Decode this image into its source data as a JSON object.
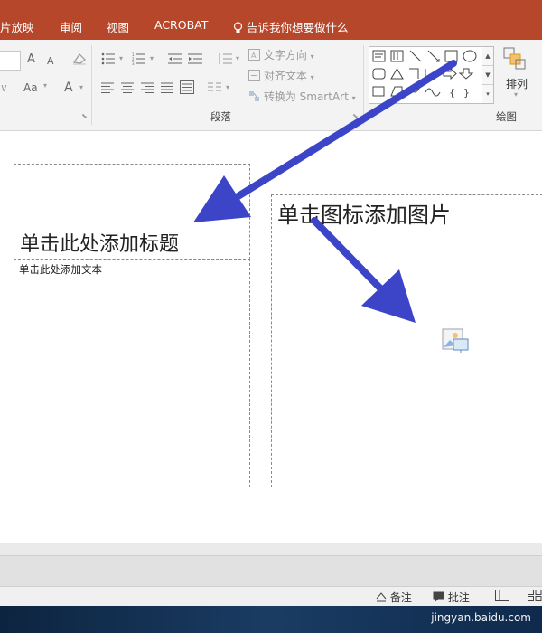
{
  "ribbon_tabs": [
    "片放映",
    "审阅",
    "视图",
    "ACROBAT"
  ],
  "tell_me": "告诉我你想要做什么",
  "paragraph": {
    "text_direction": "文字方向",
    "align_text": "对齐文本",
    "convert_smartart": "转换为 SmartArt",
    "group_label": "段落"
  },
  "font": {
    "grow": "A",
    "shrink": "A",
    "case": "Aa",
    "color_a": "A"
  },
  "drawing": {
    "arrange_label": "排列",
    "group_label": "绘图"
  },
  "slide": {
    "title_placeholder": "单击此处添加标题",
    "text_placeholder": "单击此处添加文本",
    "content_placeholder": "单击图标添加图片"
  },
  "status": {
    "notes": "备注",
    "comments": "批注"
  },
  "watermark": "jingyan.baidu.com",
  "colors": {
    "accent": "#b7472a",
    "arrow": "#3c45c8"
  }
}
